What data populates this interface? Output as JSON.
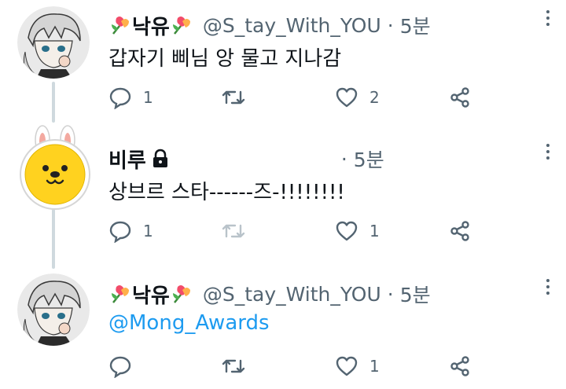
{
  "tweets": [
    {
      "name": "낙유",
      "handle": "@S_tay_With_YOU",
      "time": "5분",
      "text": "갑자기 삐님 앙 물고 지나감",
      "reply_count": "1",
      "retweet_count": "",
      "like_count": "2"
    },
    {
      "name": "비루",
      "handle": "",
      "time": "5분",
      "text": "상브르 스타------즈-!!!!!!!!",
      "reply_count": "1",
      "retweet_count": "",
      "like_count": "1"
    },
    {
      "name": "낙유",
      "handle": "@S_tay_With_YOU",
      "time": "5분",
      "text": "@Mong_Awards",
      "reply_count": "",
      "retweet_count": "",
      "like_count": "1"
    }
  ],
  "colors": {
    "text": "#0f1419",
    "muted": "#536471",
    "link": "#1d9bf0",
    "thread_line": "#cfd9de"
  },
  "icons": [
    "more-icon",
    "reply-icon",
    "retweet-icon",
    "like-icon",
    "share-icon",
    "lock-icon",
    "tulip-icon"
  ]
}
